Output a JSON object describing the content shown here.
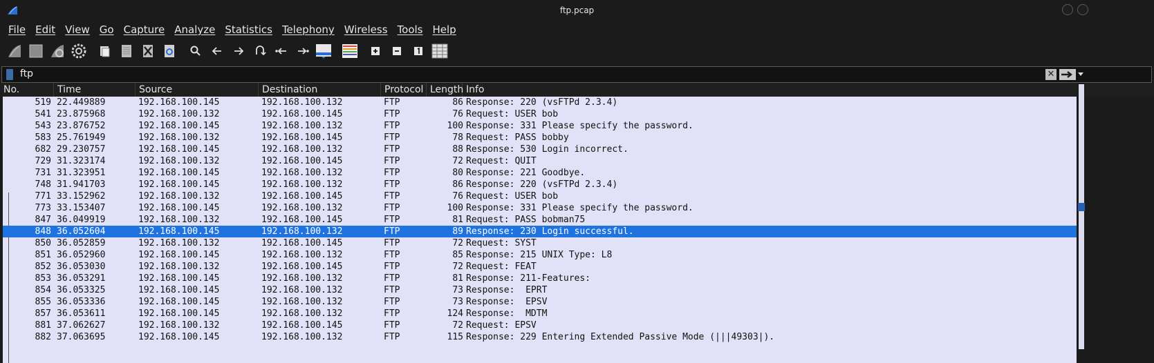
{
  "window": {
    "title": "ftp.pcap"
  },
  "menu": [
    "File",
    "Edit",
    "View",
    "Go",
    "Capture",
    "Analyze",
    "Statistics",
    "Telephony",
    "Wireless",
    "Tools",
    "Help"
  ],
  "toolbar": {
    "icons": [
      "start-capture-icon",
      "stop-capture-icon",
      "restart-capture-icon",
      "capture-options-icon",
      "open-file-icon",
      "save-file-icon",
      "close-file-icon",
      "reload-file-icon",
      "find-packet-icon",
      "go-back-icon",
      "go-forward-icon",
      "go-to-packet-icon",
      "first-packet-icon",
      "last-packet-icon",
      "auto-scroll-icon",
      "colorize-icon",
      "zoom-in-icon",
      "zoom-out-icon",
      "normal-size-icon",
      "resize-columns-icon"
    ]
  },
  "filter": {
    "value": "ftp"
  },
  "columns": [
    "No.",
    "Time",
    "Source",
    "Destination",
    "Protocol",
    "Length",
    "Info"
  ],
  "packets": [
    {
      "no": "519",
      "time": "22.449889",
      "src": "192.168.100.145",
      "dst": "192.168.100.132",
      "proto": "FTP",
      "len": "86",
      "info": "Response: 220 (vsFTPd 2.3.4)"
    },
    {
      "no": "541",
      "time": "23.875968",
      "src": "192.168.100.132",
      "dst": "192.168.100.145",
      "proto": "FTP",
      "len": "76",
      "info": "Request: USER bob"
    },
    {
      "no": "543",
      "time": "23.876752",
      "src": "192.168.100.145",
      "dst": "192.168.100.132",
      "proto": "FTP",
      "len": "100",
      "info": "Response: 331 Please specify the password."
    },
    {
      "no": "583",
      "time": "25.761949",
      "src": "192.168.100.132",
      "dst": "192.168.100.145",
      "proto": "FTP",
      "len": "78",
      "info": "Request: PASS bobby"
    },
    {
      "no": "682",
      "time": "29.230757",
      "src": "192.168.100.145",
      "dst": "192.168.100.132",
      "proto": "FTP",
      "len": "88",
      "info": "Response: 530 Login incorrect."
    },
    {
      "no": "729",
      "time": "31.323174",
      "src": "192.168.100.132",
      "dst": "192.168.100.145",
      "proto": "FTP",
      "len": "72",
      "info": "Request: QUIT"
    },
    {
      "no": "731",
      "time": "31.323951",
      "src": "192.168.100.145",
      "dst": "192.168.100.132",
      "proto": "FTP",
      "len": "80",
      "info": "Response: 221 Goodbye."
    },
    {
      "no": "748",
      "time": "31.941703",
      "src": "192.168.100.145",
      "dst": "192.168.100.132",
      "proto": "FTP",
      "len": "86",
      "info": "Response: 220 (vsFTPd 2.3.4)"
    },
    {
      "no": "771",
      "time": "33.152962",
      "src": "192.168.100.132",
      "dst": "192.168.100.145",
      "proto": "FTP",
      "len": "76",
      "info": "Request: USER bob"
    },
    {
      "no": "773",
      "time": "33.153407",
      "src": "192.168.100.145",
      "dst": "192.168.100.132",
      "proto": "FTP",
      "len": "100",
      "info": "Response: 331 Please specify the password."
    },
    {
      "no": "847",
      "time": "36.049919",
      "src": "192.168.100.132",
      "dst": "192.168.100.145",
      "proto": "FTP",
      "len": "81",
      "info": "Request: PASS bobman75"
    },
    {
      "no": "848",
      "time": "36.052604",
      "src": "192.168.100.145",
      "dst": "192.168.100.132",
      "proto": "FTP",
      "len": "89",
      "info": "Response: 230 Login successful.",
      "selected": true
    },
    {
      "no": "850",
      "time": "36.052859",
      "src": "192.168.100.132",
      "dst": "192.168.100.145",
      "proto": "FTP",
      "len": "72",
      "info": "Request: SYST"
    },
    {
      "no": "851",
      "time": "36.052960",
      "src": "192.168.100.145",
      "dst": "192.168.100.132",
      "proto": "FTP",
      "len": "85",
      "info": "Response: 215 UNIX Type: L8"
    },
    {
      "no": "852",
      "time": "36.053030",
      "src": "192.168.100.132",
      "dst": "192.168.100.145",
      "proto": "FTP",
      "len": "72",
      "info": "Request: FEAT"
    },
    {
      "no": "853",
      "time": "36.053291",
      "src": "192.168.100.145",
      "dst": "192.168.100.132",
      "proto": "FTP",
      "len": "81",
      "info": "Response: 211-Features:"
    },
    {
      "no": "854",
      "time": "36.053325",
      "src": "192.168.100.145",
      "dst": "192.168.100.132",
      "proto": "FTP",
      "len": "73",
      "info": "Response:  EPRT"
    },
    {
      "no": "855",
      "time": "36.053336",
      "src": "192.168.100.145",
      "dst": "192.168.100.132",
      "proto": "FTP",
      "len": "73",
      "info": "Response:  EPSV"
    },
    {
      "no": "857",
      "time": "36.053611",
      "src": "192.168.100.145",
      "dst": "192.168.100.132",
      "proto": "FTP",
      "len": "124",
      "info": "Response:  MDTM"
    },
    {
      "no": "881",
      "time": "37.062627",
      "src": "192.168.100.132",
      "dst": "192.168.100.145",
      "proto": "FTP",
      "len": "72",
      "info": "Request: EPSV"
    },
    {
      "no": "882",
      "time": "37.063695",
      "src": "192.168.100.145",
      "dst": "192.168.100.132",
      "proto": "FTP",
      "len": "115",
      "info": "Response: 229 Entering Extended Passive Mode (|||49303|)."
    }
  ],
  "colors": {
    "row_bg": "#e1e1f7",
    "selected_bg": "#1f73e0",
    "window_bg": "#1b1b1b"
  }
}
